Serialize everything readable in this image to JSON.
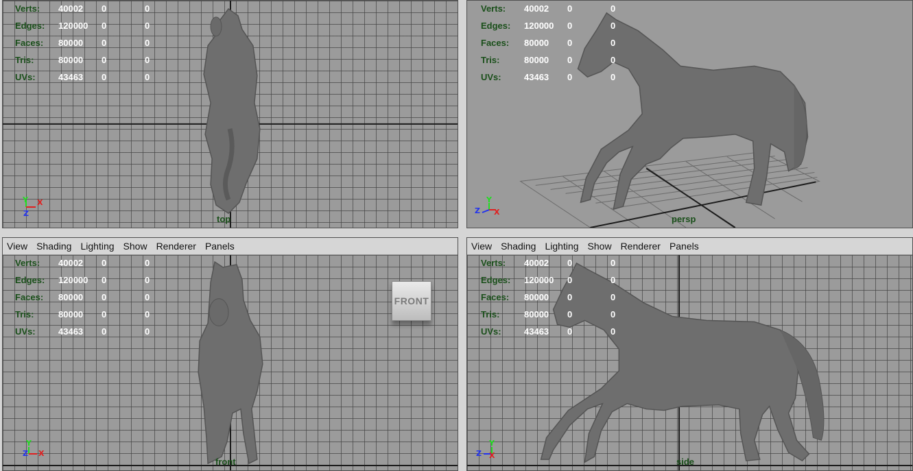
{
  "menu": [
    "View",
    "Shading",
    "Lighting",
    "Show",
    "Renderer",
    "Panels"
  ],
  "stats": [
    {
      "label": "Verts:",
      "v1": "40002",
      "v2": "0",
      "v3": "0"
    },
    {
      "label": "Edges:",
      "v1": "120000",
      "v2": "0",
      "v3": "0"
    },
    {
      "label": "Faces:",
      "v1": "80000",
      "v2": "0",
      "v3": "0"
    },
    {
      "label": "Tris:",
      "v1": "80000",
      "v2": "0",
      "v3": "0"
    },
    {
      "label": "UVs:",
      "v1": "43463",
      "v2": "0",
      "v3": "0"
    }
  ],
  "views": {
    "top": {
      "camera": "top",
      "axis_h": "X",
      "axis_v": "Y",
      "axis_d": "Z"
    },
    "persp": {
      "camera": "persp",
      "axis_h": "X",
      "axis_v": "Y",
      "axis_d": "Z"
    },
    "front": {
      "camera": "front",
      "axis_h": "X",
      "axis_v": "Y",
      "axis_d": "Z"
    },
    "side": {
      "camera": "side",
      "axis_h": "X",
      "axis_v": "Y",
      "axis_d": "Z"
    }
  },
  "viewcube": {
    "label": "FRONT"
  },
  "colors": {
    "viewport_bg": "#9b9b9b",
    "hud_label": "#1a4f1a",
    "hud_value": "#ffffff",
    "axis_x": "#e02020",
    "axis_y": "#22dd22",
    "axis_z": "#2233ee",
    "model": "#6e6e6e"
  },
  "icons": {
    "axis_indicator": "xyz-axis-gizmo-icon",
    "viewcube": "viewcube-icon"
  }
}
